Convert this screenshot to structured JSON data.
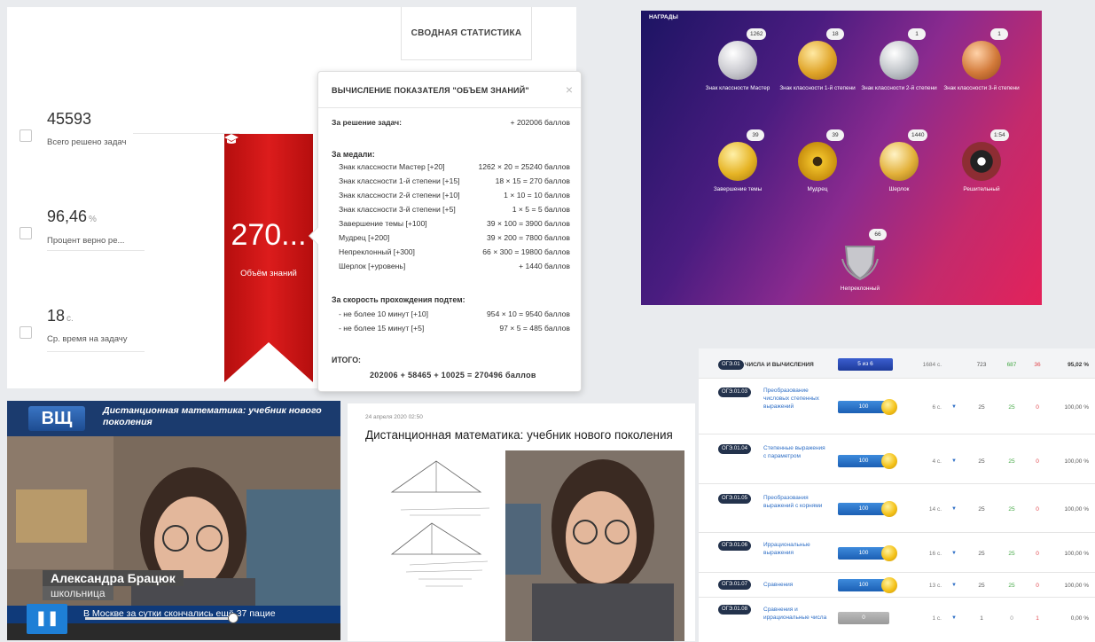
{
  "stats": {
    "header": "СВОДНАЯ СТАТИСТИКА",
    "items": [
      {
        "value": "45593",
        "unit": "",
        "caption": "Всего решено задач",
        "icon": "edit-icon"
      },
      {
        "value": "96,46",
        "unit": "%",
        "caption": "Процент верно ре...",
        "icon": "check-icon"
      },
      {
        "value": "18",
        "unit": "с.",
        "caption": "Ср. время на задачу",
        "icon": "flag-icon"
      }
    ],
    "ribbon_value": "270...",
    "ribbon_caption": "Объём знаний",
    "ribbon_color": "#d01414"
  },
  "popup": {
    "title": "ВЫЧИСЛЕНИЕ ПОКАЗАТЕЛЯ \"ОБЪЕМ ЗНАНИЙ\"",
    "close": "×",
    "tasks_label": "За решение задач:",
    "tasks_value": "+ 202006  баллов",
    "medals_header": "За медали:",
    "medal_rows": [
      {
        "label": "Знак классности Мастер [+20]",
        "value": "1262 × 20 = 25240  баллов"
      },
      {
        "label": "Знак классности 1-й степени [+15]",
        "value": "18 × 15 = 270  баллов"
      },
      {
        "label": "Знак классности 2-й степени [+10]",
        "value": "1 × 10 = 10  баллов"
      },
      {
        "label": "Знак классности 3-й степени [+5]",
        "value": "1 × 5 = 5  баллов"
      },
      {
        "label": "Завершение темы [+100]",
        "value": "39 × 100 = 3900  баллов"
      },
      {
        "label": "Мудрец [+200]",
        "value": "39 × 200 = 7800  баллов"
      },
      {
        "label": "Непреклонный [+300]",
        "value": "66 × 300 = 19800  баллов"
      },
      {
        "label": "Шерлок [+уровень]",
        "value": "+ 1440  баллов"
      }
    ],
    "speed_header": "За скорость прохождения подтем:",
    "speed_rows": [
      {
        "label": "- не более 10 минут [+10]",
        "value": "954 × 10 = 9540  баллов"
      },
      {
        "label": "- не более 15 минут [+5]",
        "value": "97 × 5 = 485  баллов"
      }
    ],
    "total_header": "ИТОГО:",
    "total_value": "202006 + 58465 + 10025  =  270496  баллов"
  },
  "awards": {
    "title": "НАГРАДЫ",
    "medals": [
      {
        "name": "Знак классности Мастер",
        "count": "1262",
        "icon": "silver-master-medal-icon",
        "color": "#c9c9cf"
      },
      {
        "name": "Знак классности 1-й степени",
        "count": "18",
        "icon": "gold-medal-icon",
        "color": "#e0a52a"
      },
      {
        "name": "Знак классности 2-й степени",
        "count": "1",
        "icon": "silver-medal-icon",
        "color": "#bfc3c8"
      },
      {
        "name": "Знак классности 3-й степени",
        "count": "1",
        "icon": "bronze-medal-icon",
        "color": "#d27a3a"
      },
      {
        "name": "Завершение темы",
        "count": "39",
        "icon": "topic-complete-medal-icon",
        "color": "#e6b425"
      },
      {
        "name": "Мудрец",
        "count": "39",
        "icon": "sage-medal-icon",
        "color": "#f0c12a"
      },
      {
        "name": "Шерлок",
        "count": "1440",
        "icon": "sherlock-medal-icon",
        "color": "#e3b13a"
      },
      {
        "name": "Решительный",
        "count": "1:54",
        "icon": "decisive-medal-icon",
        "color": "#8d2d33"
      },
      {
        "name": "Непреклонный",
        "count": "66",
        "icon": "unyielding-shield-icon",
        "color": "#c7c7cc"
      }
    ]
  },
  "video": {
    "logo": "ВЩ",
    "headline": "Дистанционная математика: учебник нового поколения",
    "person_name": "Александра Брацюк",
    "person_role": "школьница",
    "ticker": "В Москве за сутки скончались ещё 37 пацие",
    "play_icon": "pause-icon"
  },
  "article": {
    "date": "24 апреля 2020   02:50",
    "title": "Дистанционная математика: учебник нового поколения"
  },
  "topics": {
    "header": {
      "code": "ОГЭ.01",
      "name": "ЧИСЛА И ВЫЧИСЛЕНИЯ",
      "progress": "5 из 6",
      "time": "1684 с.",
      "count": "723",
      "correct": "687",
      "wrong": "36",
      "percent": "95,02 %"
    },
    "rows": [
      {
        "code": "ОГЭ.01.03",
        "name": "Преобразование числовых степенных выражений",
        "progress": "100",
        "time": "6 с.",
        "count": "25",
        "correct": "25",
        "wrong": "0",
        "percent": "100,00 %"
      },
      {
        "code": "ОГЭ.01.04",
        "name": "Степенные выражения с параметром",
        "progress": "100",
        "time": "4 с.",
        "count": "25",
        "correct": "25",
        "wrong": "0",
        "percent": "100,00 %"
      },
      {
        "code": "ОГЭ.01.05",
        "name": "Преобразования выражений с корнями",
        "progress": "100",
        "time": "14 с.",
        "count": "25",
        "correct": "25",
        "wrong": "0",
        "percent": "100,00 %"
      },
      {
        "code": "ОГЭ.01.06",
        "name": "Иррациональные выражения",
        "progress": "100",
        "time": "16 с.",
        "count": "25",
        "correct": "25",
        "wrong": "0",
        "percent": "100,00 %"
      },
      {
        "code": "ОГЭ.01.07",
        "name": "Сравнения",
        "progress": "100",
        "time": "13 с.",
        "count": "25",
        "correct": "25",
        "wrong": "0",
        "percent": "100,00 %"
      },
      {
        "code": "ОГЭ.01.08",
        "name": "Сравнения и иррациональные числа",
        "progress": "0",
        "time": "1 с.",
        "count": "1",
        "correct": "0",
        "wrong": "1",
        "percent": "0,00 %"
      }
    ]
  }
}
